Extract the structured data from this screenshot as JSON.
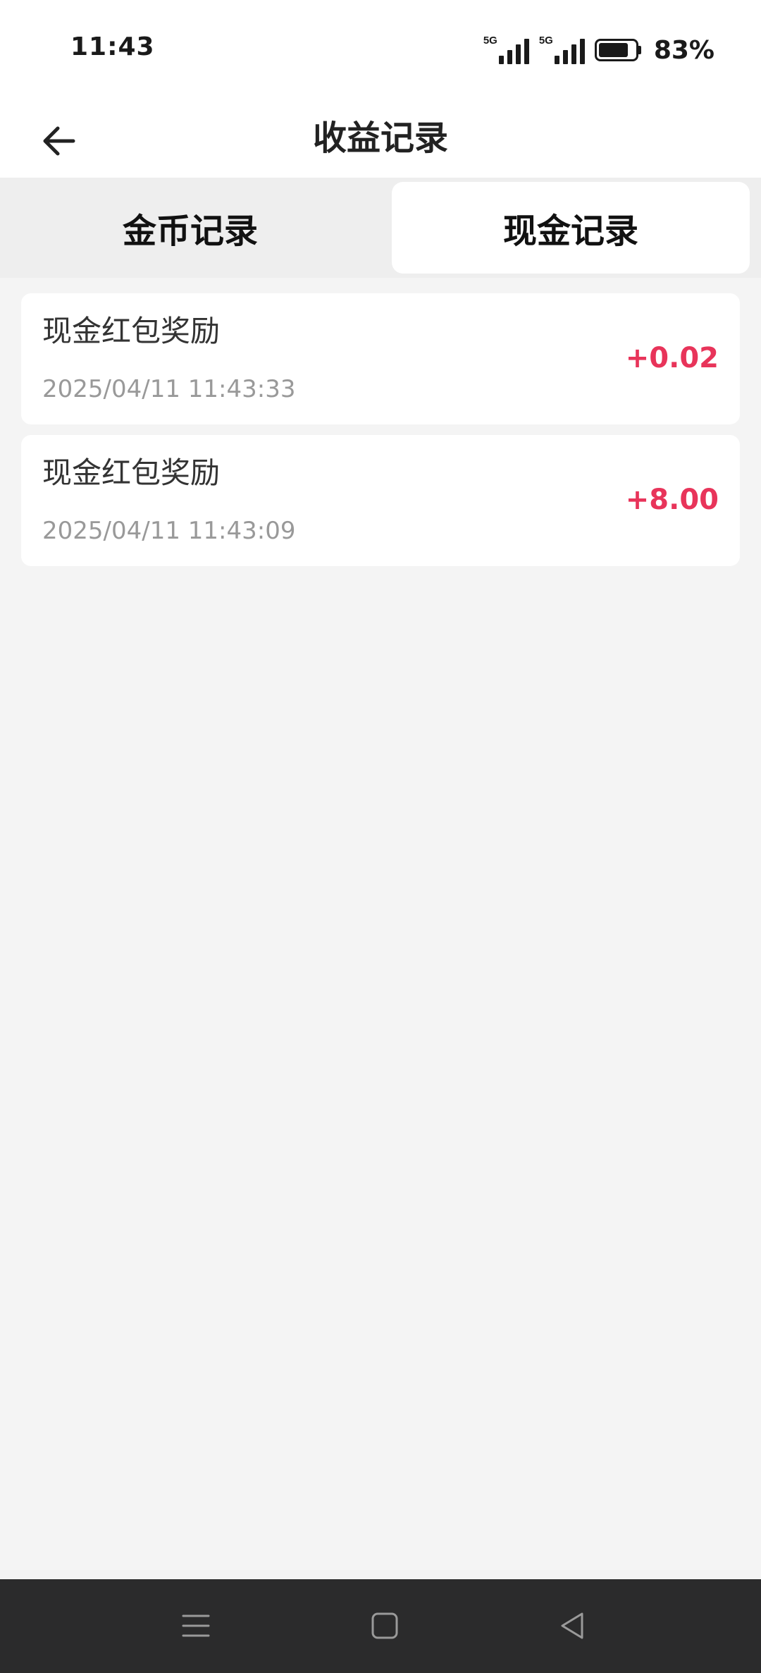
{
  "status_bar": {
    "time": "11:43",
    "network_1": "5G",
    "network_2": "5G",
    "battery_percent": "83%",
    "battery_level": 0.83
  },
  "header": {
    "title": "收益记录",
    "back_icon": "arrow-left-icon"
  },
  "tabs": [
    {
      "label": "金币记录",
      "active": false
    },
    {
      "label": "现金记录",
      "active": true
    }
  ],
  "records": [
    {
      "title": "现金红包奖励",
      "time": "2025/04/11 11:43:33",
      "amount": "+0.02"
    },
    {
      "title": "现金红包奖励",
      "time": "2025/04/11 11:43:09",
      "amount": "+8.00"
    }
  ],
  "colors": {
    "amount": "#e8345a",
    "background": "#f4f4f4",
    "navbar": "#2b2b2c"
  },
  "nav_bar": {
    "icons": [
      "menu-icon",
      "home-icon",
      "back-triangle-icon"
    ]
  }
}
